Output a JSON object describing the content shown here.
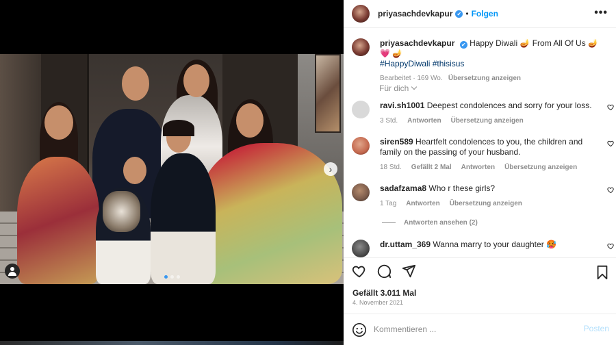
{
  "post": {
    "username": "priyasachdevkapur",
    "verified_mark": "✔",
    "separator": "•",
    "follow_label": "Folgen",
    "more_label": "•••",
    "carousel_next_label": "›",
    "carousel_page": 1,
    "carousel_total": 3
  },
  "caption": {
    "username": "priyasachdevkapur",
    "text": "Happy Diwali 🪔 From All Of Us 🪔 💗 🪔",
    "hashtags": "#HappyDiwali #thisisus",
    "edited": "Bearbeitet",
    "age": "169 Wo.",
    "translate": "Übersetzung anzeigen"
  },
  "filter": {
    "label": "Für dich"
  },
  "comments": [
    {
      "username": "ravi.sh1001",
      "text": "Deepest condolences and sorry for your loss.",
      "age": "3 Std.",
      "likes": "",
      "reply": "Antworten",
      "translate": "Übersetzung anzeigen",
      "avatar_color": "#d9d9d9"
    },
    {
      "username": "siren589",
      "text": "Heartfelt condolences to you, the children and family on the passing of your husband.",
      "age": "18 Std.",
      "likes": "Gefällt 2 Mal",
      "reply": "Antworten",
      "translate": "Übersetzung anzeigen",
      "avatar_color": "#c4684e"
    },
    {
      "username": "sadafzama8",
      "text": "Who r these girls?",
      "age": "1 Tag",
      "likes": "",
      "reply": "Antworten",
      "translate": "Übersetzung anzeigen",
      "avatar_color": "#7a5a4a"
    },
    {
      "username": "dr.uttam_369",
      "text": "Wanna marry to your daughter 🥵",
      "age": "",
      "likes": "",
      "reply": "",
      "translate": "",
      "avatar_color": "#4a4a4a"
    }
  ],
  "replies": {
    "label": "Antworten ansehen (2)"
  },
  "stats": {
    "likes": "Gefällt 3.011 Mal",
    "date": "4. November 2021"
  },
  "compose": {
    "placeholder": "Kommentieren ...",
    "post_label": "Posten"
  },
  "icons": {
    "like": "heart-icon",
    "comment": "comment-icon",
    "share": "share-icon",
    "save": "bookmark-icon",
    "emoji": "emoji-icon",
    "tag": "user-tag-icon"
  },
  "colors": {
    "link": "#0095f6",
    "hashtag": "#00376b",
    "muted": "#8e8e8e",
    "post_disabled": "#b2dffc"
  }
}
